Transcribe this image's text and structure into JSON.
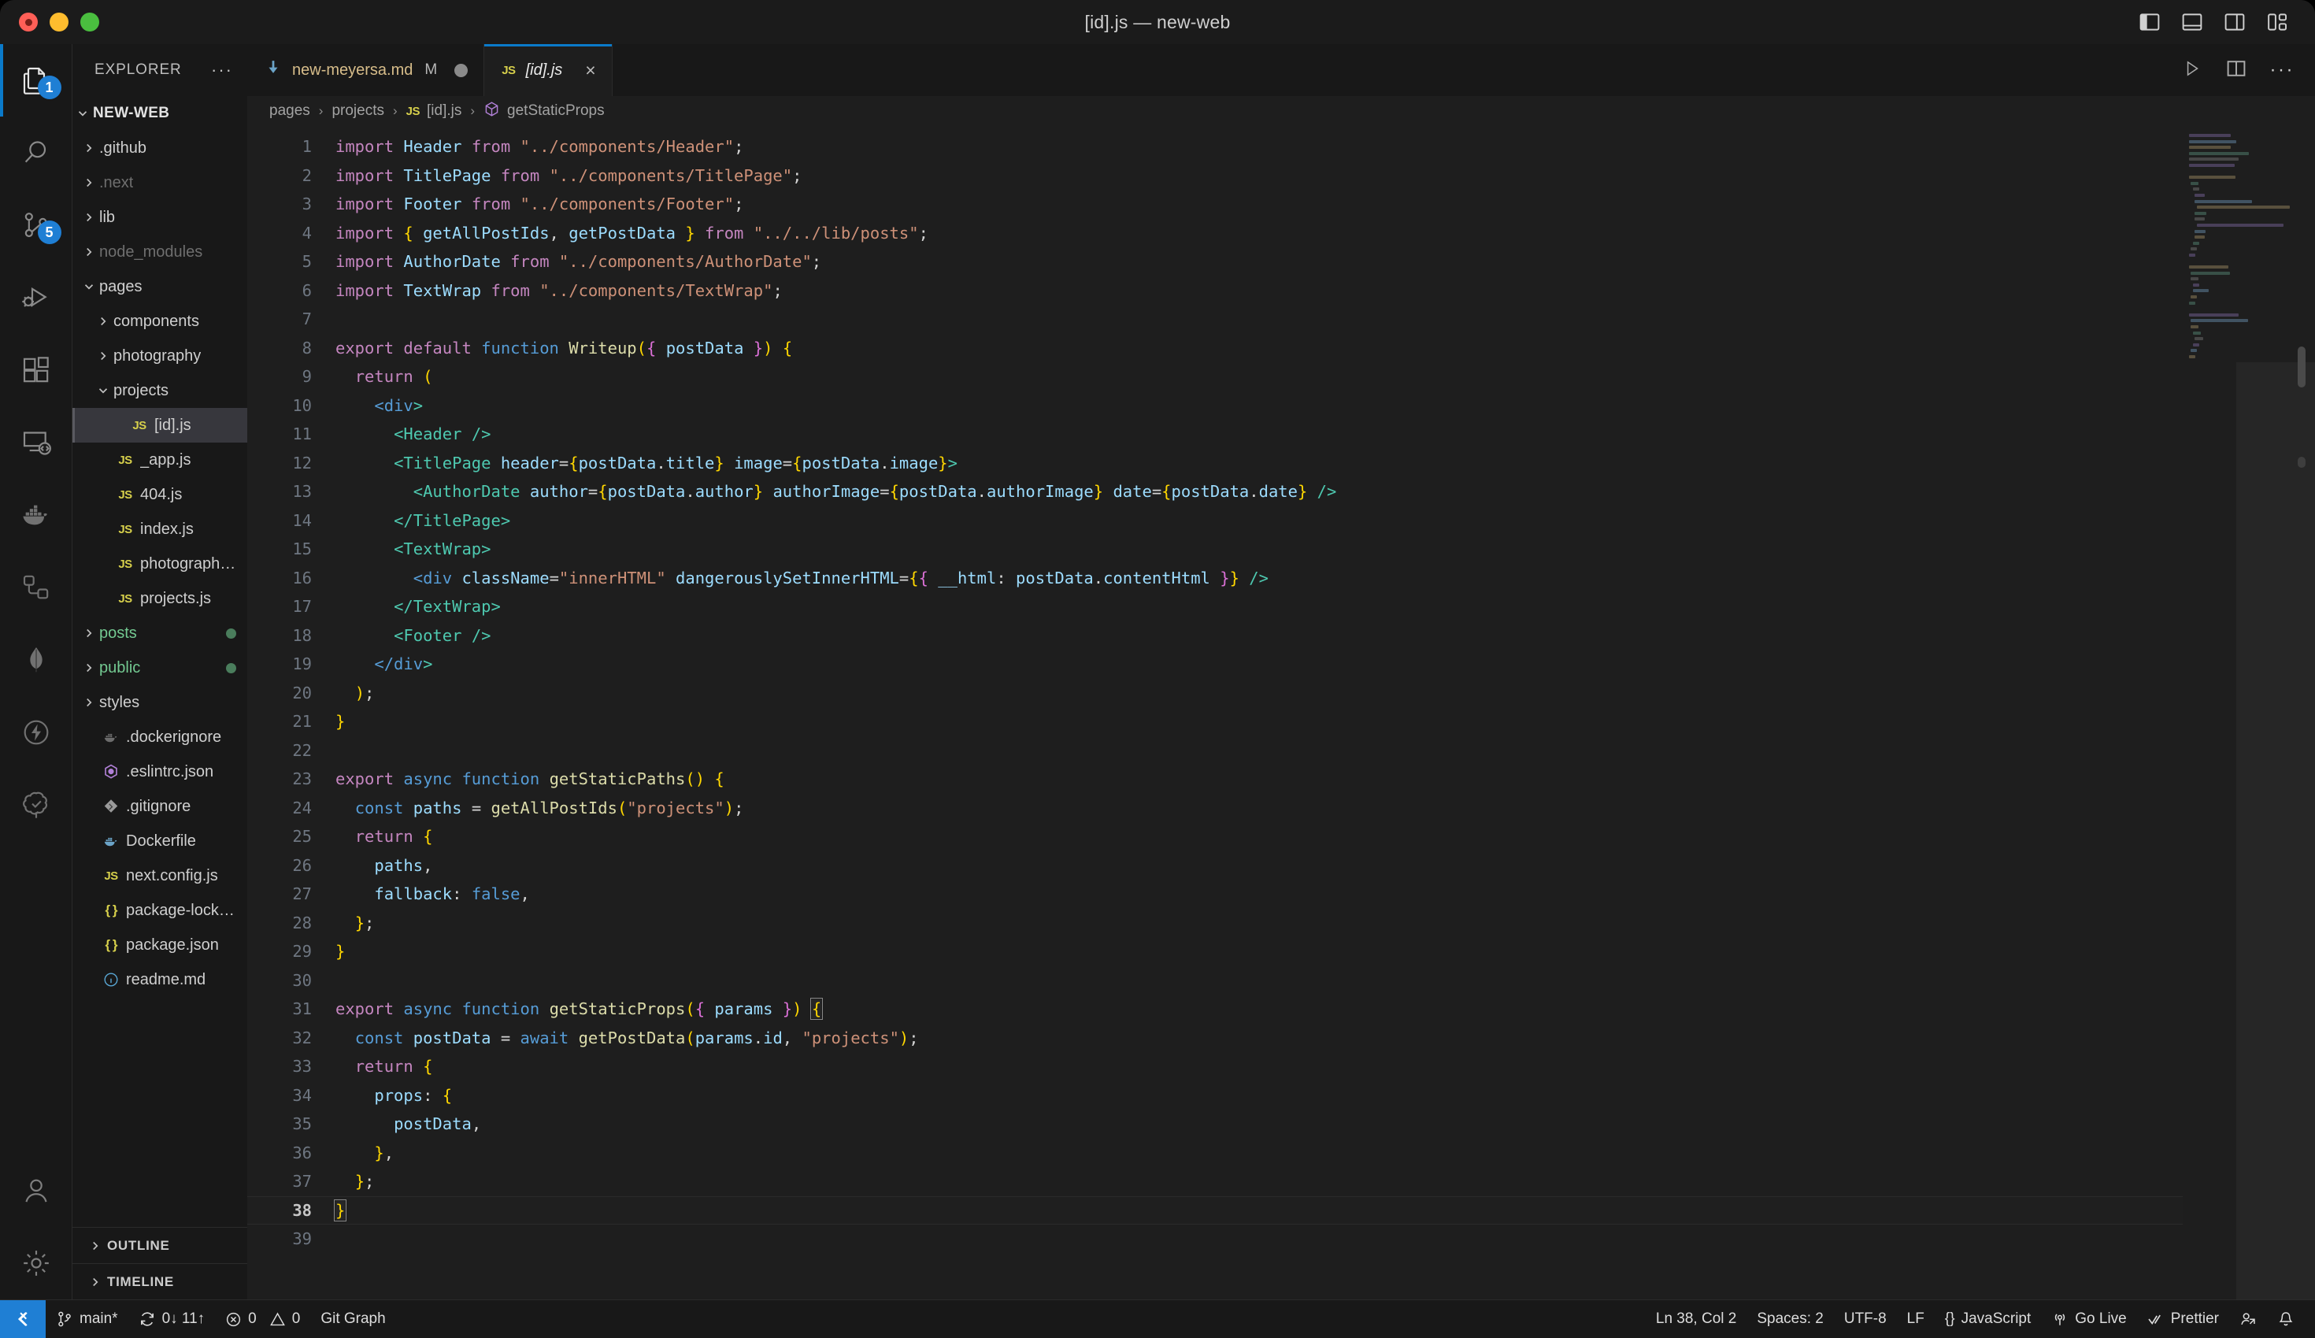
{
  "window": {
    "title": "[id].js — new-web",
    "traffic_lights": [
      "close",
      "minimize",
      "zoom"
    ],
    "layout_icons": [
      "toggle-primary-sidebar",
      "toggle-panel",
      "toggle-secondary-sidebar",
      "customize-layout"
    ]
  },
  "activity_bar": {
    "items": [
      {
        "name": "explorer",
        "icon": "files-icon",
        "badge": "1",
        "active": true
      },
      {
        "name": "search",
        "icon": "search-icon",
        "badge": "",
        "active": false
      },
      {
        "name": "source-control",
        "icon": "source-control-icon",
        "badge": "5",
        "active": false
      },
      {
        "name": "run-and-debug",
        "icon": "run-debug-icon",
        "badge": "",
        "active": false
      },
      {
        "name": "extensions",
        "icon": "extensions-icon",
        "badge": "",
        "active": false
      },
      {
        "name": "remote-explorer",
        "icon": "remote-explorer-icon",
        "badge": "",
        "active": false
      },
      {
        "name": "docker",
        "icon": "docker-whale-icon",
        "badge": "",
        "active": false
      },
      {
        "name": "kubernetes",
        "icon": "kubernetes-icon",
        "badge": "",
        "active": false
      },
      {
        "name": "mongodb",
        "icon": "mongodb-leaf-icon",
        "badge": "",
        "active": false
      },
      {
        "name": "thunder-client",
        "icon": "lightning-bolt-icon",
        "badge": "",
        "active": false
      },
      {
        "name": "todo-tree",
        "icon": "tree-check-icon",
        "badge": "",
        "active": false
      }
    ],
    "bottom_items": [
      {
        "name": "accounts",
        "icon": "account-icon"
      },
      {
        "name": "manage",
        "icon": "gear-icon"
      }
    ]
  },
  "sidebar": {
    "title": "EXPLORER",
    "more_actions": "···",
    "root": {
      "label": "NEW-WEB",
      "expanded": true
    },
    "tree": [
      {
        "label": ".github",
        "type": "folder",
        "indent": 1,
        "expanded": false,
        "state": "normal"
      },
      {
        "label": ".next",
        "type": "folder",
        "indent": 1,
        "expanded": false,
        "state": "ignored"
      },
      {
        "label": "lib",
        "type": "folder",
        "indent": 1,
        "expanded": false,
        "state": "normal"
      },
      {
        "label": "node_modules",
        "type": "folder",
        "indent": 1,
        "expanded": false,
        "state": "ignored"
      },
      {
        "label": "pages",
        "type": "folder",
        "indent": 1,
        "expanded": true,
        "state": "normal"
      },
      {
        "label": "components",
        "type": "folder",
        "indent": 2,
        "expanded": false,
        "state": "normal"
      },
      {
        "label": "photography",
        "type": "folder",
        "indent": 2,
        "expanded": false,
        "state": "normal"
      },
      {
        "label": "projects",
        "type": "folder",
        "indent": 2,
        "expanded": true,
        "state": "normal"
      },
      {
        "label": "[id].js",
        "type": "js",
        "indent": 3,
        "selected": true,
        "state": "normal"
      },
      {
        "label": "_app.js",
        "type": "js",
        "indent": 2,
        "state": "normal"
      },
      {
        "label": "404.js",
        "type": "js",
        "indent": 2,
        "state": "normal"
      },
      {
        "label": "index.js",
        "type": "js",
        "indent": 2,
        "state": "normal"
      },
      {
        "label": "photography.js",
        "type": "js",
        "indent": 2,
        "state": "normal"
      },
      {
        "label": "projects.js",
        "type": "js",
        "indent": 2,
        "state": "normal"
      },
      {
        "label": "posts",
        "type": "folder",
        "indent": 1,
        "expanded": false,
        "state": "untracked",
        "git_dot": true
      },
      {
        "label": "public",
        "type": "folder",
        "indent": 1,
        "expanded": false,
        "state": "untracked",
        "git_dot": true
      },
      {
        "label": "styles",
        "type": "folder",
        "indent": 1,
        "expanded": false,
        "state": "normal"
      },
      {
        "label": ".dockerignore",
        "type": "docker-dim",
        "indent": 1,
        "state": "normal"
      },
      {
        "label": ".eslintrc.json",
        "type": "eslint",
        "indent": 1,
        "state": "normal"
      },
      {
        "label": ".gitignore",
        "type": "git",
        "indent": 1,
        "state": "normal"
      },
      {
        "label": "Dockerfile",
        "type": "docker",
        "indent": 1,
        "state": "normal"
      },
      {
        "label": "next.config.js",
        "type": "js",
        "indent": 1,
        "state": "normal"
      },
      {
        "label": "package-lock.json",
        "type": "json",
        "indent": 1,
        "state": "normal"
      },
      {
        "label": "package.json",
        "type": "json",
        "indent": 1,
        "state": "normal"
      },
      {
        "label": "readme.md",
        "type": "info",
        "indent": 1,
        "state": "normal"
      }
    ],
    "panels": [
      {
        "label": "OUTLINE",
        "expanded": false
      },
      {
        "label": "TIMELINE",
        "expanded": false
      }
    ]
  },
  "tabs": [
    {
      "label": "new-meyersa.md",
      "icon": "markdown-download-icon",
      "modified_badge": "M",
      "dirty": true,
      "active": false
    },
    {
      "label": "[id].js",
      "icon": "js-icon",
      "modified_badge": "",
      "dirty": false,
      "active": true,
      "close": "×"
    }
  ],
  "editor_actions": [
    {
      "name": "run-code-button",
      "icon": "play-icon"
    },
    {
      "name": "split-editor-right-button",
      "icon": "split-editor-icon"
    },
    {
      "name": "more-actions-button",
      "icon": "ellipsis-icon",
      "label": "···"
    }
  ],
  "breadcrumb": [
    {
      "label": "pages",
      "icon": ""
    },
    {
      "label": "projects",
      "icon": ""
    },
    {
      "label": "[id].js",
      "icon": "js-icon"
    },
    {
      "label": "getStaticProps",
      "icon": "symbol-method-icon"
    }
  ],
  "editor": {
    "language": "JavaScript",
    "current_line": 38,
    "total_lines": 39,
    "lines": [
      {
        "n": 1,
        "text": "import Header from \"../components/Header\";"
      },
      {
        "n": 2,
        "text": "import TitlePage from \"../components/TitlePage\";"
      },
      {
        "n": 3,
        "text": "import Footer from \"../components/Footer\";"
      },
      {
        "n": 4,
        "text": "import { getAllPostIds, getPostData } from \"../../lib/posts\";"
      },
      {
        "n": 5,
        "text": "import AuthorDate from \"../components/AuthorDate\";"
      },
      {
        "n": 6,
        "text": "import TextWrap from \"../components/TextWrap\";"
      },
      {
        "n": 7,
        "text": ""
      },
      {
        "n": 8,
        "text": "export default function Writeup({ postData }) {"
      },
      {
        "n": 9,
        "text": "  return ("
      },
      {
        "n": 10,
        "text": "    <div>"
      },
      {
        "n": 11,
        "text": "      <Header />"
      },
      {
        "n": 12,
        "text": "      <TitlePage header={postData.title} image={postData.image}>"
      },
      {
        "n": 13,
        "text": "        <AuthorDate author={postData.author} authorImage={postData.authorImage} date={postData.date} />"
      },
      {
        "n": 14,
        "text": "      </TitlePage>"
      },
      {
        "n": 15,
        "text": "      <TextWrap>"
      },
      {
        "n": 16,
        "text": "        <div className=\"innerHTML\" dangerouslySetInnerHTML={{ __html: postData.contentHtml }} />"
      },
      {
        "n": 17,
        "text": "      </TextWrap>"
      },
      {
        "n": 18,
        "text": "      <Footer />"
      },
      {
        "n": 19,
        "text": "    </div>"
      },
      {
        "n": 20,
        "text": "  );"
      },
      {
        "n": 21,
        "text": "}"
      },
      {
        "n": 22,
        "text": ""
      },
      {
        "n": 23,
        "text": "export async function getStaticPaths() {"
      },
      {
        "n": 24,
        "text": "  const paths = getAllPostIds(\"projects\");"
      },
      {
        "n": 25,
        "text": "  return {"
      },
      {
        "n": 26,
        "text": "    paths,"
      },
      {
        "n": 27,
        "text": "    fallback: false,"
      },
      {
        "n": 28,
        "text": "  };"
      },
      {
        "n": 29,
        "text": "}"
      },
      {
        "n": 30,
        "text": ""
      },
      {
        "n": 31,
        "text": "export async function getStaticProps({ params }) {"
      },
      {
        "n": 32,
        "text": "  const postData = await getPostData(params.id, \"projects\");"
      },
      {
        "n": 33,
        "text": "  return {"
      },
      {
        "n": 34,
        "text": "    props: {"
      },
      {
        "n": 35,
        "text": "      postData,"
      },
      {
        "n": 36,
        "text": "    },"
      },
      {
        "n": 37,
        "text": "  };"
      },
      {
        "n": 38,
        "text": "}"
      },
      {
        "n": 39,
        "text": ""
      }
    ]
  },
  "status_bar": {
    "remote_icon": "remote-window-icon",
    "left": [
      {
        "name": "branch",
        "icon": "git-branch-icon",
        "label": "main*"
      },
      {
        "name": "sync",
        "icon": "sync-icon",
        "label": "0↓ 11↑"
      },
      {
        "name": "errors",
        "icon": "error-icon",
        "label": "0"
      },
      {
        "name": "warnings",
        "icon": "warning-icon",
        "label": "0"
      },
      {
        "name": "git-graph",
        "icon": "",
        "label": "Git Graph"
      }
    ],
    "right": [
      {
        "name": "cursor-position",
        "icon": "",
        "label": "Ln 38, Col 2"
      },
      {
        "name": "indentation",
        "icon": "",
        "label": "Spaces: 2"
      },
      {
        "name": "encoding",
        "icon": "",
        "label": "UTF-8"
      },
      {
        "name": "eol",
        "icon": "",
        "label": "LF"
      },
      {
        "name": "language-mode",
        "icon": "json-braces-icon",
        "label": "JavaScript"
      },
      {
        "name": "go-live",
        "icon": "broadcast-icon",
        "label": "Go Live"
      },
      {
        "name": "prettier",
        "icon": "check-check-icon",
        "label": "Prettier"
      },
      {
        "name": "remote-account",
        "icon": "account-icon",
        "label": ""
      },
      {
        "name": "notifications",
        "icon": "bell-icon",
        "label": ""
      }
    ]
  },
  "colors": {
    "accent": "#0a7aca",
    "badge": "#1f7fd4",
    "editor_bg": "#1e1e1e",
    "sidebar_bg": "#181818",
    "untracked_green": "#73c991"
  }
}
